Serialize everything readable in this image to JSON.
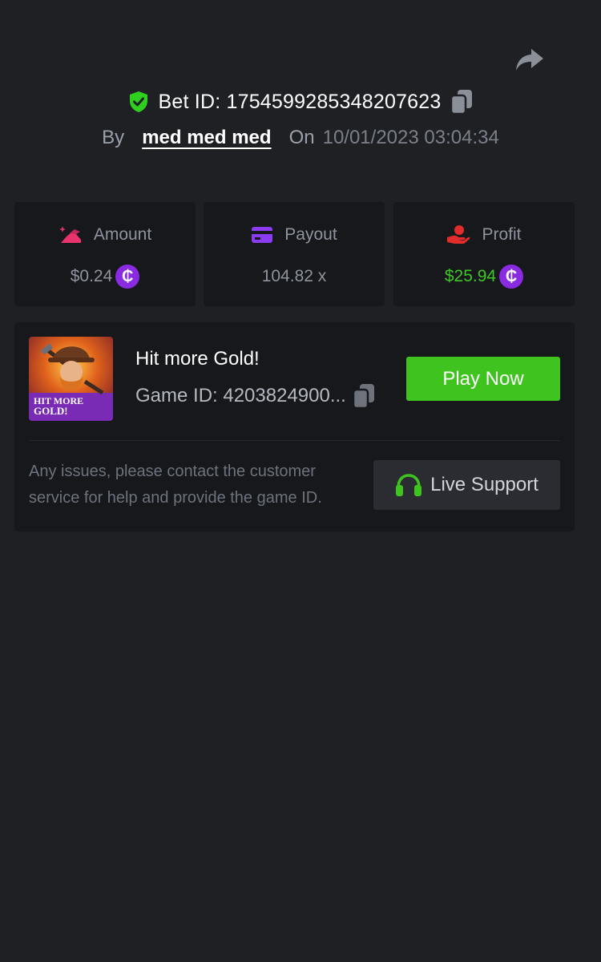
{
  "header": {
    "bet_id_label": "Bet ID: 1754599285348207623",
    "by_label": "By",
    "user_name": "med med med",
    "on_label": "On",
    "datetime": "10/01/2023 03:04:34"
  },
  "stats": {
    "amount": {
      "label": "Amount",
      "value": "$0.24"
    },
    "payout": {
      "label": "Payout",
      "value": "104.82 x"
    },
    "profit": {
      "label": "Profit",
      "value": "$25.94"
    },
    "coin_symbol": "₵"
  },
  "game": {
    "title": "Hit more Gold!",
    "game_id": "Game ID: 4203824900...",
    "thumb_text_line1": "HIT MORE",
    "thumb_text_line2": "GOLD!",
    "play_label": "Play Now"
  },
  "support": {
    "help_text": "Any issues, please contact the customer service for help and provide the game ID.",
    "button_label": "Live Support"
  },
  "colors": {
    "background": "#1f2024",
    "card": "#17181c",
    "accent_green": "#3fc31e",
    "profit_green": "#3fc728",
    "coin_purple": "#8a2be2",
    "amount_pink": "#e8336d",
    "payout_purple": "#8b3cf0",
    "profit_red": "#e22b2b"
  },
  "icons": [
    "share-icon",
    "shield-check-icon",
    "copy-icon",
    "amount-icon",
    "card-icon",
    "profit-hand-icon",
    "coin-icon",
    "headset-icon"
  ]
}
